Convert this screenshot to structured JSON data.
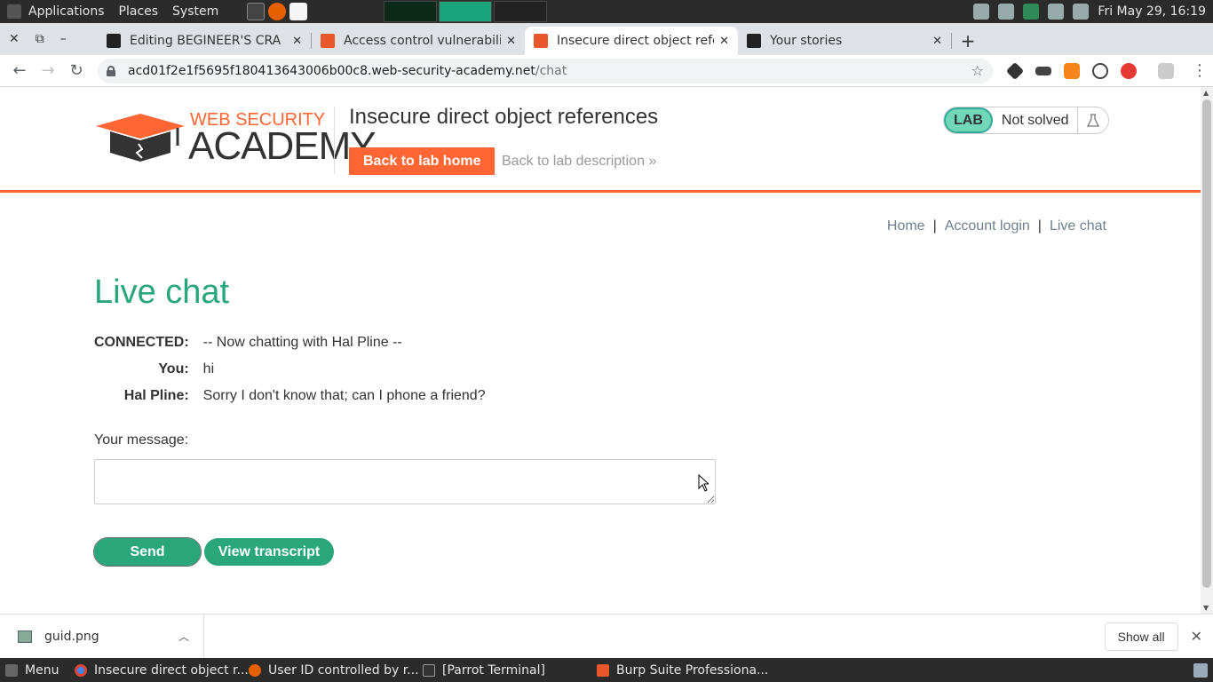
{
  "desktop": {
    "menus": [
      "Applications",
      "Places",
      "System"
    ],
    "clock": "Fri May 29, 16:19"
  },
  "browser": {
    "tabs": [
      {
        "title": "Editing BEGINEER'S CRA",
        "favicon": "medium-icon",
        "active": false
      },
      {
        "title": "Access control vulnerabili",
        "favicon": "portswigger-icon",
        "active": false
      },
      {
        "title": "Insecure direct object refe",
        "favicon": "portswigger-icon",
        "active": true
      },
      {
        "title": "Your stories",
        "favicon": "medium-icon",
        "active": false
      }
    ],
    "url_host": "acd01f2e1f5695f180413643006b00c8.web-security-academy.net",
    "url_path": "/chat"
  },
  "lab": {
    "logo_top": "WEB SECURITY",
    "logo_bottom": "ACADEMY",
    "title": "Insecure direct object references",
    "back_home": "Back to lab home",
    "back_description": "Back to lab description",
    "badge": "LAB",
    "status": "Not solved",
    "status_color": "#70d8b8"
  },
  "nav": {
    "links": [
      "Home",
      "Account login",
      "Live chat"
    ],
    "separator": "|"
  },
  "chat": {
    "heading": "Live chat",
    "messages": [
      {
        "who": "CONNECTED:",
        "text": "-- Now chatting with Hal Pline --"
      },
      {
        "who": "You:",
        "text": "hi"
      },
      {
        "who": "Hal Pline:",
        "text": "Sorry I don't know that; can I phone a friend?"
      }
    ],
    "message_label": "Your message:",
    "message_value": "",
    "send": "Send",
    "view_transcript": "View transcript",
    "accent": "#29a67a"
  },
  "downloads": {
    "file": "guid.png",
    "show_all": "Show all"
  },
  "taskbar": {
    "menu": "Menu",
    "windows": [
      "Insecure direct object r...",
      "User ID controlled by r...",
      "[Parrot Terminal]",
      "Burp Suite Professiona..."
    ]
  }
}
